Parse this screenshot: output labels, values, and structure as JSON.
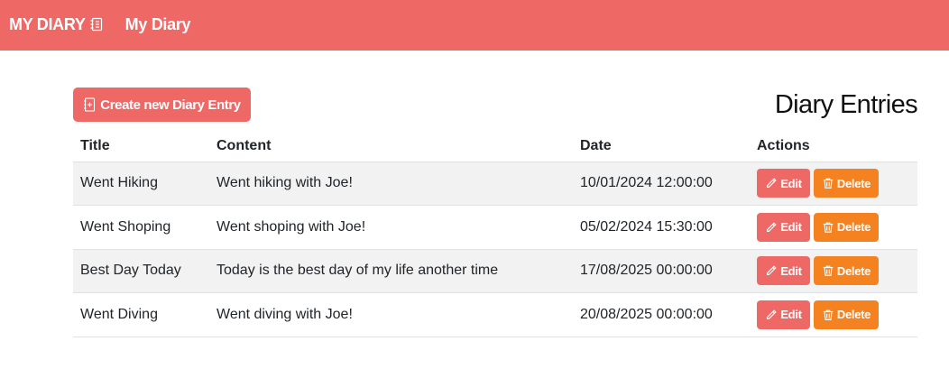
{
  "navbar": {
    "brand": "MY DIARY",
    "brand_icon": "journal-icon",
    "link": "My Diary",
    "color": "#ee6866"
  },
  "toolbar": {
    "create_label": "Create new Diary Entry",
    "create_icon": "journal-plus-icon"
  },
  "page_title": "Diary Entries",
  "table": {
    "headers": [
      "Title",
      "Content",
      "Date",
      "Actions"
    ],
    "rows": [
      {
        "title": "Went Hiking",
        "content": "Went hiking with Joe!",
        "date": "10/01/2024 12:00:00"
      },
      {
        "title": "Went Shoping",
        "content": "Went shoping with Joe!",
        "date": "05/02/2024 15:30:00"
      },
      {
        "title": "Best Day Today",
        "content": "Today is the best day of my life another time",
        "date": "17/08/2025 00:00:00"
      },
      {
        "title": "Went Diving",
        "content": "Went diving with Joe!",
        "date": "20/08/2025 00:00:00"
      }
    ],
    "edit_label": "Edit",
    "delete_label": "Delete",
    "edit_icon": "pencil-icon",
    "delete_icon": "trash-icon",
    "edit_color": "#ee6866",
    "delete_color": "#f58220"
  }
}
